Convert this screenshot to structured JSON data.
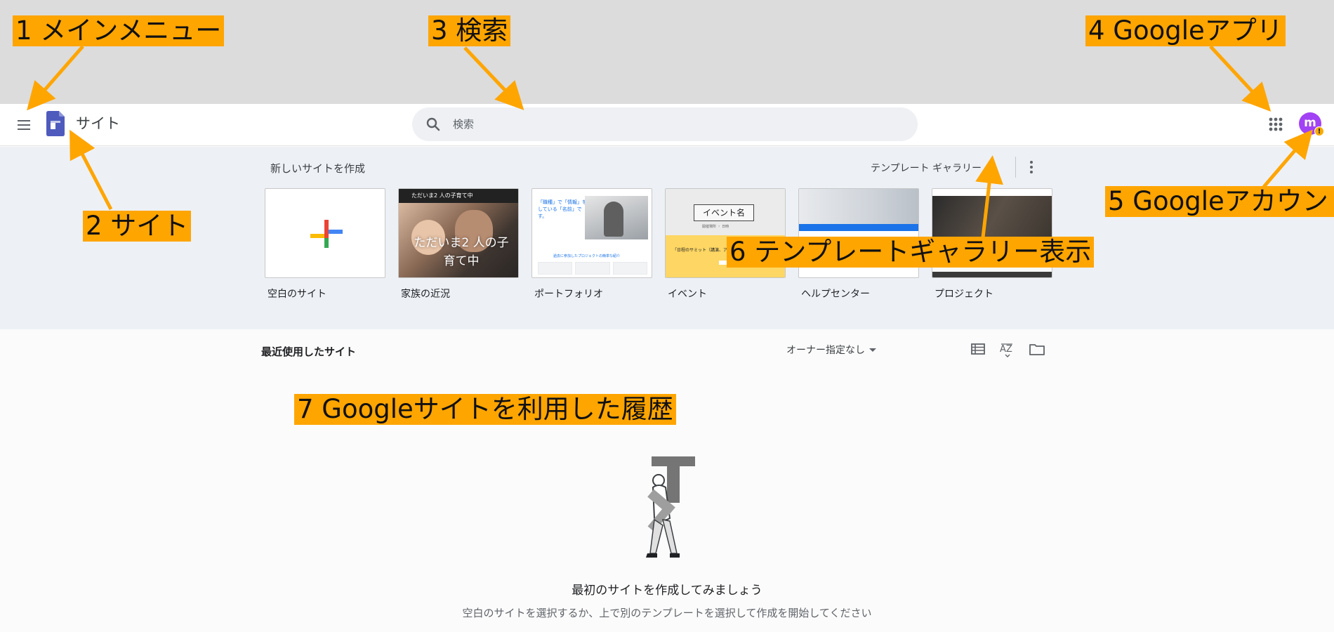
{
  "appbar": {
    "title": "サイト",
    "search_placeholder": "検索",
    "avatar_letter": "m",
    "avatar_badge": "!"
  },
  "templates": {
    "section_title": "新しいサイトを作成",
    "gallery_label": "テンプレート ギャラリー",
    "items": [
      {
        "label": "空白のサイト"
      },
      {
        "label": "家族の近況",
        "bar_text": "ただいま2 人の子育て中",
        "overlay_text": "ただいま2 人の子育て中"
      },
      {
        "label": "ポートフォリオ",
        "headline": "「職種」で「情報」をしている「名前」です。",
        "caption": "過去に参加したプロジェクトの簡単な紹介"
      },
      {
        "label": "イベント",
        "title_box": "イベント名",
        "subtitle": "開催場所 ・ 日時",
        "yellow_text": "「日程のサミット（講演、アジェンダ…」"
      },
      {
        "label": "ヘルプセンター"
      },
      {
        "label": "プロジェクト"
      }
    ]
  },
  "recent": {
    "title": "最近使用したサイト",
    "owner_filter": "オーナー指定なし",
    "empty_title": "最初のサイトを作成してみましょう",
    "empty_subtitle": "空白のサイトを選択するか、上で別のテンプレートを選択して作成を開始してください"
  },
  "annotations": {
    "a1": "1 メインメニュー",
    "a2": "2 サイト",
    "a3": "3 検索",
    "a4": "4 Googleアプリ",
    "a5": "5 Googleアカウント",
    "a6": "6 テンプレートギャラリー表示",
    "a7": "7 Googleサイトを利用した履歴"
  },
  "colors": {
    "annotation": "#ffa500",
    "arrow": "#ffa500",
    "sites_logo": "#4e5bbd",
    "avatar": "#a142f4",
    "template_band": "#edf1f6"
  }
}
